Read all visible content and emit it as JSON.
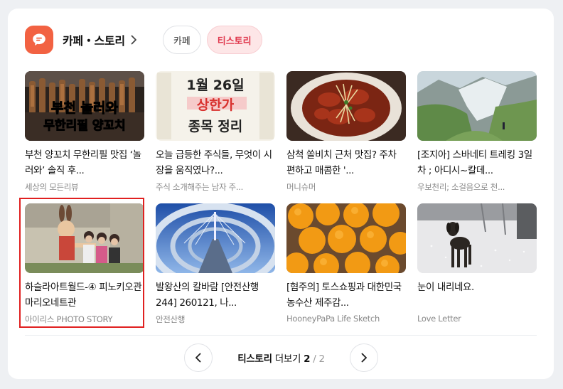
{
  "header": {
    "title": "카페・스토리",
    "tabs": [
      {
        "label": "카페",
        "active": false
      },
      {
        "label": "티스토리",
        "active": true
      }
    ],
    "accent_color": "#f26242"
  },
  "items": [
    {
      "thumb_text": [
        "부천 놀러와",
        "무한리필 양꼬치"
      ],
      "title": "부천 양꼬치 무한리필 맛집 ‘놀러와’ 솔직 후...",
      "source": "세상의 모든리뷰"
    },
    {
      "thumb_text": [
        "1월 26일",
        "상한가",
        "종목 정리"
      ],
      "title": "오늘 급등한 주식들, 무엇이 시장을 움직였나?...",
      "source": "주식 소개해주는 남자 주..."
    },
    {
      "title": "삼척 쏠비치 근처 맛집? 주차 편하고 매콤한 '...",
      "source": "머니슈머"
    },
    {
      "title": "[조지아] 스바네티 트레킹 3일차 ; 아디시~칼데...",
      "source": "우보천리; 소걸음으로 천..."
    },
    {
      "title": "하슬라아트월드-④ 피노키오관 마리오네트관",
      "source": "아이리스 PHOTO STORY",
      "highlighted": true
    },
    {
      "title": "발왕산의 칼바람 [안전산행 244] 260121, 나...",
      "source": "안전산행"
    },
    {
      "title": "[혐주의] 토스쇼핑과 대한민국농수산 제주감...",
      "source": "HooneyPaPa Life Sketch"
    },
    {
      "title": "눈이 내리네요.",
      "source": "Love Letter"
    }
  ],
  "pager": {
    "label": "티스토리",
    "more": "더보기",
    "current": "2",
    "separator": "/",
    "total": "2"
  }
}
